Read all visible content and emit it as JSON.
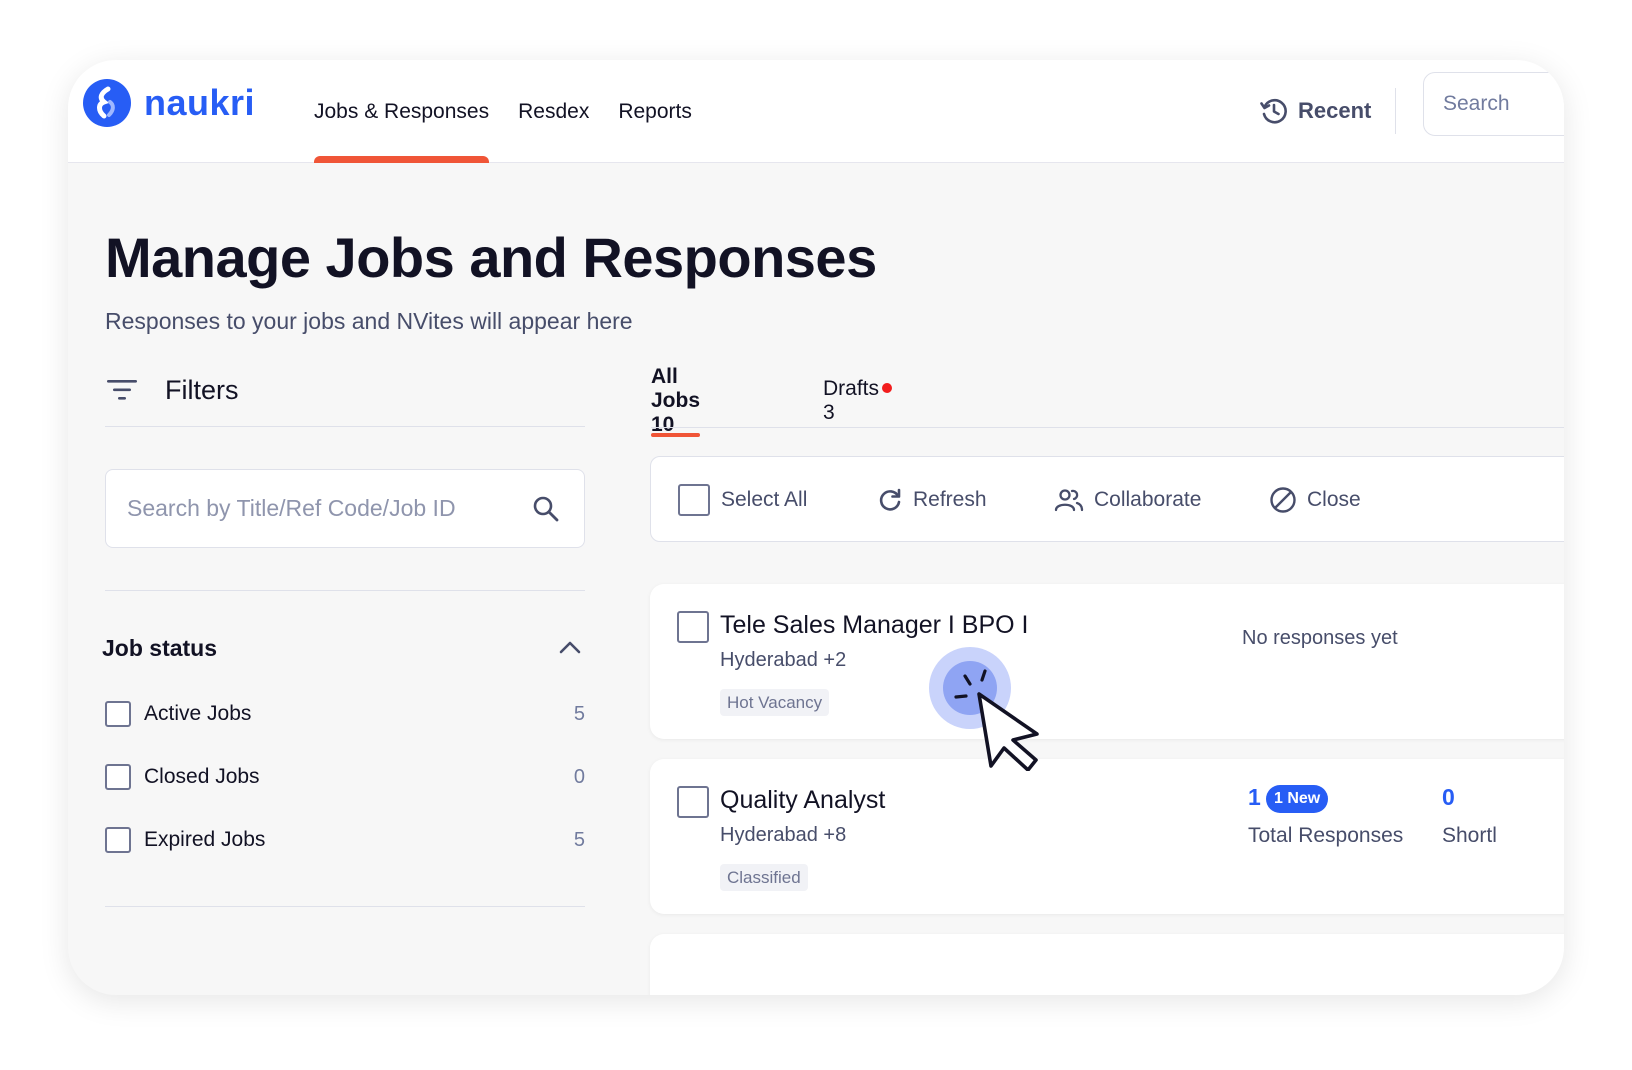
{
  "brand": {
    "name": "naukri",
    "color": "#275df5"
  },
  "nav": {
    "items": [
      {
        "label": "Jobs & Responses",
        "active": true
      },
      {
        "label": "Resdex",
        "active": false
      },
      {
        "label": "Reports",
        "active": false
      }
    ],
    "recent_label": "Recent",
    "search_placeholder": "Search"
  },
  "page": {
    "title": "Manage Jobs and Responses",
    "subtitle": "Responses to your jobs and NVites will appear here"
  },
  "filters": {
    "label": "Filters",
    "search_placeholder": "Search by Title/Ref Code/Job ID",
    "job_status": {
      "title": "Job status",
      "options": [
        {
          "label": "Active Jobs",
          "count": "5"
        },
        {
          "label": "Closed Jobs",
          "count": "0"
        },
        {
          "label": "Expired Jobs",
          "count": "5"
        }
      ]
    }
  },
  "tabs": [
    {
      "label": "All Jobs 10",
      "active": true
    },
    {
      "label": "Drafts 3",
      "active": false,
      "notification_dot": true
    }
  ],
  "toolbar": {
    "select_all": "Select All",
    "refresh": "Refresh",
    "collaborate": "Collaborate",
    "close": "Close"
  },
  "jobs": [
    {
      "title": "Tele Sales Manager I BPO I",
      "location": "Hyderabad +2",
      "tag": "Hot Vacancy",
      "no_responses": "No responses yet"
    },
    {
      "title": "Quality Analyst",
      "location": "Hyderabad +8",
      "tag": "Classified",
      "total_responses": "1",
      "new_badge": "1 New",
      "total_responses_label": "Total Responses",
      "shortlisted": "0",
      "shortlisted_label": "Shortl"
    }
  ],
  "colors": {
    "accent": "#275df5",
    "active_underline": "#f05537",
    "notification_dot": "#f21d1d"
  }
}
